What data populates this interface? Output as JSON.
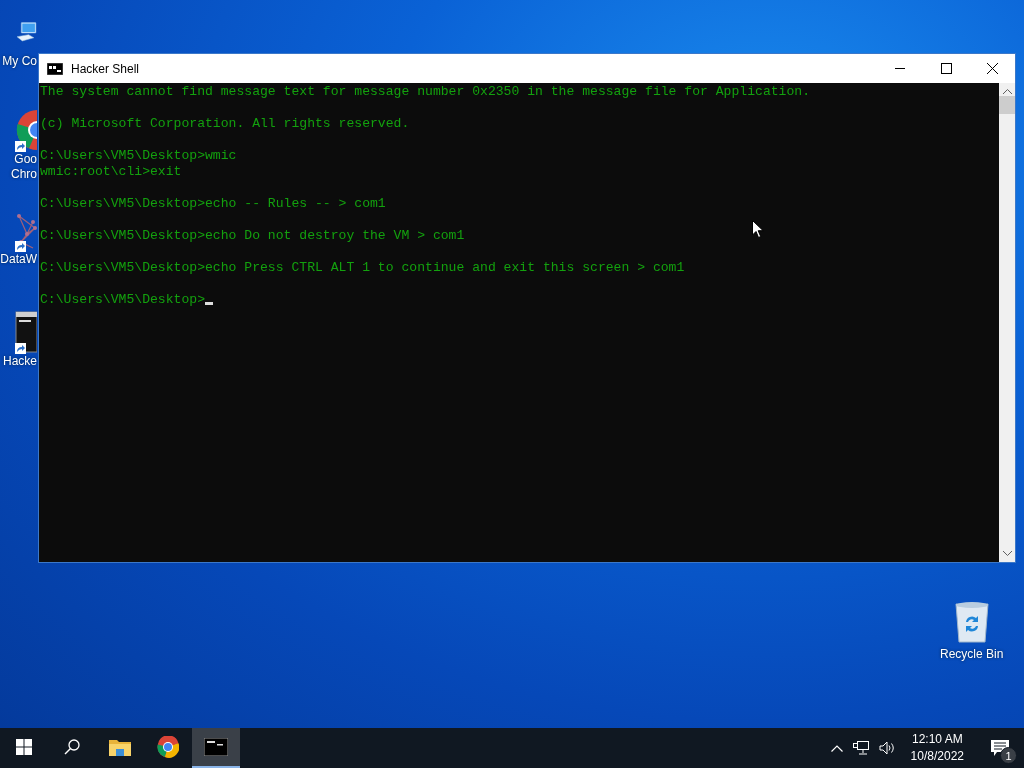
{
  "desktop_icons": [
    {
      "kind": "computer",
      "shortcut": false,
      "label_lines": [
        "My Co"
      ]
    },
    {
      "kind": "chrome",
      "shortcut": true,
      "label_lines": [
        "Goo",
        "Chro"
      ]
    },
    {
      "kind": "network",
      "shortcut": true,
      "label_lines": [
        "DataW"
      ]
    },
    {
      "kind": "console",
      "shortcut": true,
      "label_lines": [
        "Hacke"
      ]
    }
  ],
  "recycle_bin": {
    "label": "Recycle Bin"
  },
  "window": {
    "title": "Hacker Shell",
    "blocks": [
      [
        "The system cannot find message text for message number 0x2350 in the message file for Application."
      ],
      [
        "(c) Microsoft Corporation. All rights reserved."
      ],
      [
        "C:\\Users\\VM5\\Desktop>wmic",
        "wmic:root\\cli>exit"
      ],
      [
        "C:\\Users\\VM5\\Desktop>echo -- Rules -- > com1"
      ],
      [
        "C:\\Users\\VM5\\Desktop>echo Do not destroy the VM > com1"
      ],
      [
        "C:\\Users\\VM5\\Desktop>echo Press CTRL ALT 1 to continue and exit this screen > com1"
      ]
    ],
    "prompt": "C:\\Users\\VM5\\Desktop>"
  },
  "taskbar": {
    "apps": [
      {
        "kind": "start",
        "selected": false
      },
      {
        "kind": "search",
        "selected": false
      },
      {
        "kind": "folder",
        "selected": false
      },
      {
        "kind": "chrome",
        "selected": false
      },
      {
        "kind": "console",
        "selected": true
      }
    ],
    "time": "12:10 AM",
    "date": "10/8/2022",
    "notification_count": "1"
  }
}
